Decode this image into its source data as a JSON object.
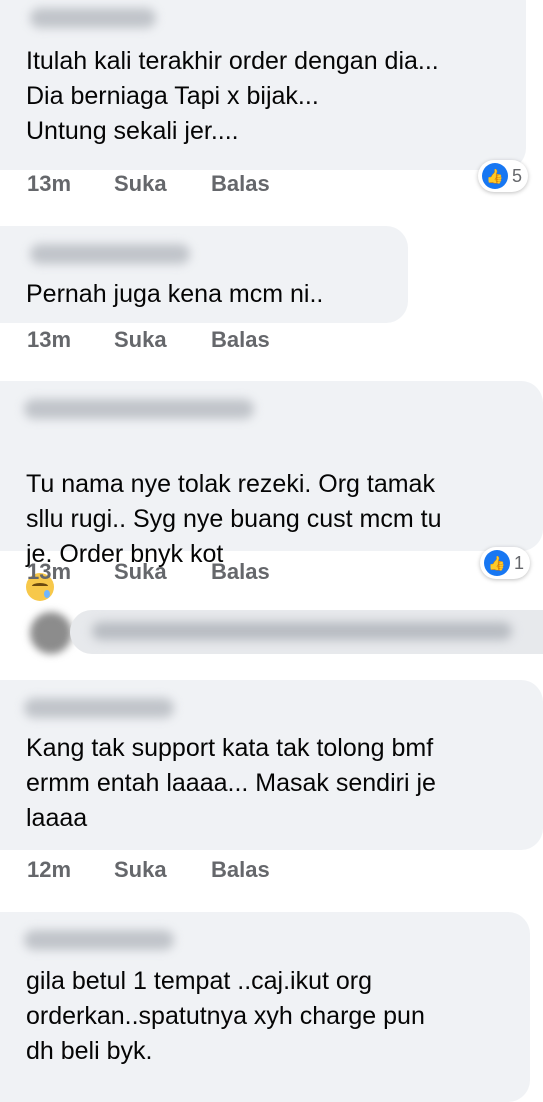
{
  "comments": [
    {
      "text": "Itulah kali terakhir order dengan dia...\nDia berniaga Tapi x bijak...\nUntung sekali jer....",
      "time": "13m",
      "like": "Suka",
      "reply": "Balas",
      "reactions": "5"
    },
    {
      "text": "Pernah juga kena mcm ni..",
      "time": "13m",
      "like": "Suka",
      "reply": "Balas"
    },
    {
      "text": "Tu nama nye tolak rezeki. Org tamak\nsllu rugi.. Syg nye buang cust mcm tu\nje. Order bnyk kot",
      "time": "13m",
      "like": "Suka",
      "reply": "Balas",
      "reactions": "1"
    },
    {
      "text": "Kang tak support kata tak tolong bmf\nermm entah laaaa... Masak sendiri je\nlaaaa",
      "time": "12m",
      "like": "Suka",
      "reply": "Balas"
    },
    {
      "text": "gila betul 1 tempat ..caj.ikut org\norderkan..spatutnya xyh charge pun\ndh beli byk.",
      "time": "",
      "like": "",
      "reply": ""
    }
  ],
  "icons": {
    "reaction": "like-icon",
    "emoji": "sleepy-face-emoji"
  },
  "colors": {
    "bubble": "#f0f2f5",
    "meta": "#65676b",
    "like_blue": "#1877f2"
  }
}
